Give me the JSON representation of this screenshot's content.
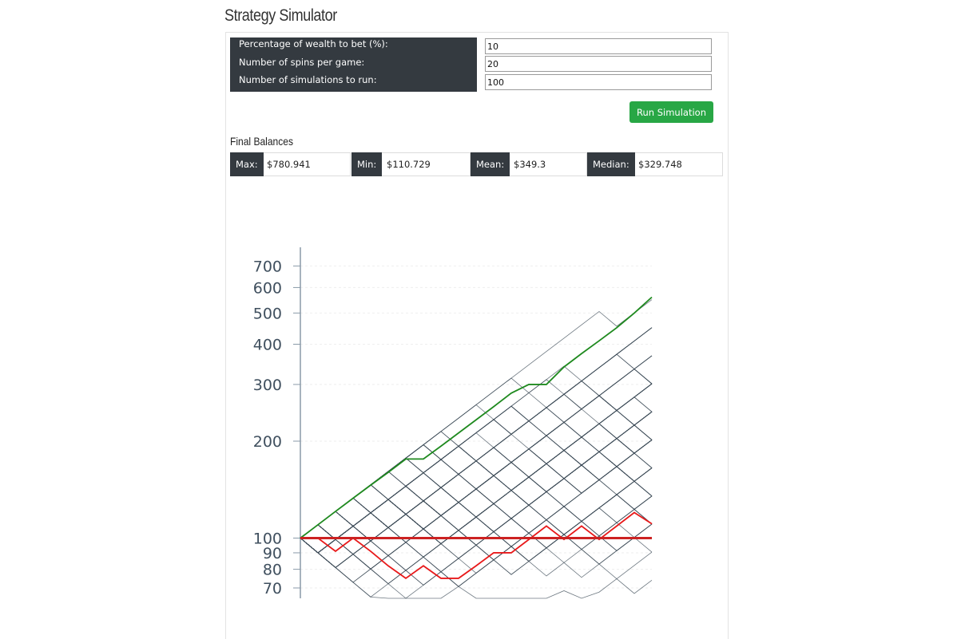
{
  "page": {
    "title": "Strategy Simulator"
  },
  "params": [
    {
      "label": "Percentage of wealth to bet (%):",
      "value": "10"
    },
    {
      "label": "Number of spins per game:",
      "value": "20"
    },
    {
      "label": "Number of simulations to run:",
      "value": "100"
    }
  ],
  "run_button": "Run Simulation",
  "final_balances": {
    "title": "Final Balances",
    "stats": [
      {
        "label": "Max:",
        "value": "$780.941"
      },
      {
        "label": "Min:",
        "value": "$110.729"
      },
      {
        "label": "Mean:",
        "value": "$349.3"
      },
      {
        "label": "Median:",
        "value": "$329.748"
      }
    ]
  },
  "colors": {
    "dark": "#343a40",
    "accent_green": "#28a745",
    "max_line": "#1f8a1f",
    "min_line": "#e8191a",
    "baseline": "#cc2222",
    "sim_lines": "#3b4a55"
  },
  "chart_data": {
    "type": "line",
    "title": "",
    "xlabel": "",
    "ylabel": "",
    "y_scale": "log",
    "xlim": [
      0,
      20
    ],
    "ylim": [
      65,
      800
    ],
    "yticks": [
      70,
      80,
      90,
      100,
      200,
      300,
      400,
      500,
      600,
      700
    ],
    "x": [
      0,
      1,
      2,
      3,
      4,
      5,
      6,
      7,
      8,
      9,
      10,
      11,
      12,
      13,
      14,
      15,
      16,
      17,
      18,
      19,
      20
    ],
    "series": [
      {
        "role": "max",
        "values": [
          100,
          110,
          121,
          133,
          146,
          160,
          176,
          176,
          193,
          212,
          233,
          256,
          282,
          300,
          300,
          340,
          374,
          410,
          450,
          500,
          560
        ]
      },
      {
        "role": "min",
        "values": [
          100,
          100,
          91,
          100,
          91,
          82,
          75,
          82,
          75,
          75,
          82,
          90,
          90,
          99,
          109,
          99,
          109,
          99,
          109,
          120,
          110.729
        ]
      },
      {
        "role": "baseline",
        "values": [
          100,
          100,
          100,
          100,
          100,
          100,
          100,
          100,
          100,
          100,
          100,
          100,
          100,
          100,
          100,
          100,
          100,
          100,
          100,
          100,
          100
        ]
      }
    ],
    "simulations": {
      "count": 100,
      "description_values_final": {
        "max": 780.941,
        "min": 110.729,
        "mean": 349.3,
        "median": 329.748
      }
    }
  }
}
